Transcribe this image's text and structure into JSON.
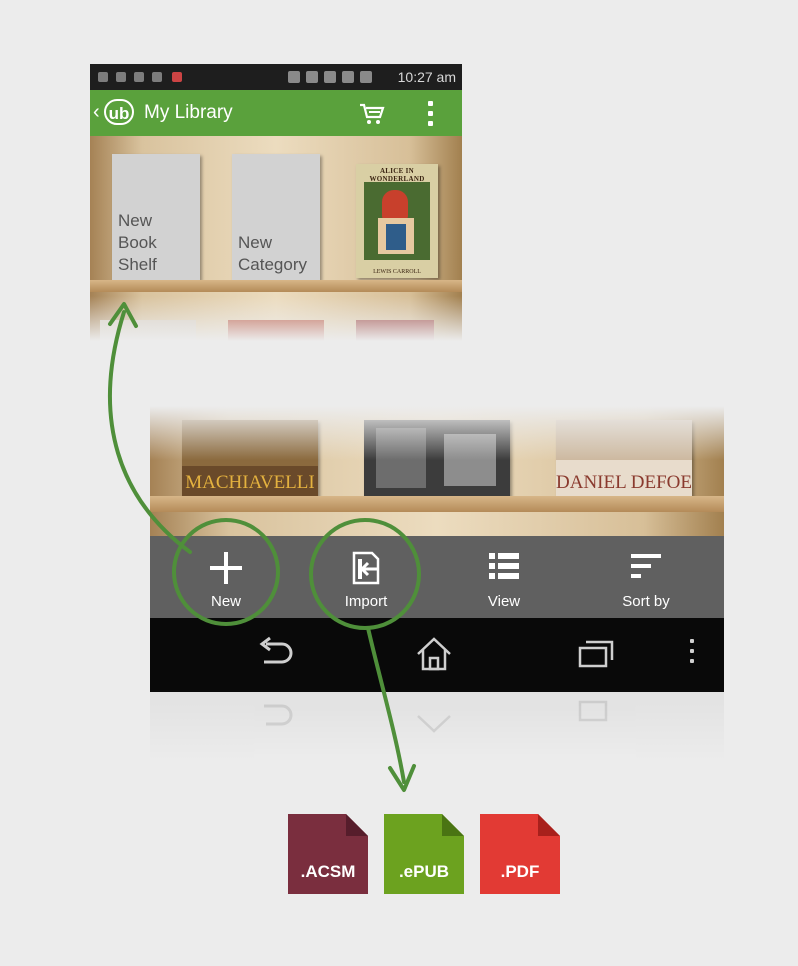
{
  "status_bar": {
    "time": "10:27 am"
  },
  "app_bar": {
    "title": "My Library",
    "logo": "ub"
  },
  "library": {
    "cards": [
      {
        "label": "New\nBook\nShelf"
      },
      {
        "label": "New\nCategory"
      }
    ],
    "alice_book": {
      "title": "ALICE IN WONDERLAND",
      "author": "LEWIS CARROLL"
    }
  },
  "shelf_books": [
    {
      "title": "MACHIAVELLI"
    },
    {
      "title": ""
    },
    {
      "title": "DANIEL DEFOE"
    }
  ],
  "toolbar": {
    "items": [
      {
        "label": "New",
        "icon": "plus-icon"
      },
      {
        "label": "Import",
        "icon": "import-icon"
      },
      {
        "label": "View",
        "icon": "list-icon"
      },
      {
        "label": "Sort by",
        "icon": "sort-icon"
      }
    ]
  },
  "nav_bar": {
    "icons": [
      "back-icon",
      "home-icon",
      "recents-icon",
      "overflow-menu-icon"
    ]
  },
  "file_types": [
    {
      "label": ".ACSM",
      "color": "#7a2e3e"
    },
    {
      "label": ".ePUB",
      "color": "#6ca21f"
    },
    {
      "label": ".PDF",
      "color": "#e23a34"
    }
  ],
  "colors": {
    "accent": "#5aa13c",
    "annotation": "#4f8f3a",
    "toolbar": "#606060",
    "nav": "#090909"
  }
}
